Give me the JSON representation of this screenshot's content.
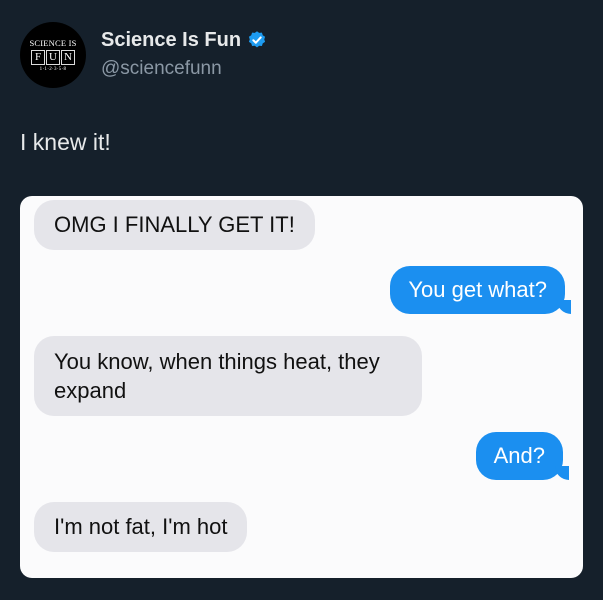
{
  "author": {
    "avatar": {
      "top": "SCIENCE IS",
      "letters": [
        "F",
        "U",
        "N"
      ],
      "bottom": "1·1·2·3·5·8"
    },
    "name": "Science Is Fun",
    "handle": "@sciencefunn",
    "verified_color": "#1d9bf0"
  },
  "tweet": {
    "text": "I knew it!"
  },
  "conversation": {
    "messages": [
      {
        "side": "received",
        "text": "OMG I FINALLY GET IT!"
      },
      {
        "side": "sent",
        "text": "You get what?"
      },
      {
        "side": "received",
        "text": "You know, when things heat, they expand"
      },
      {
        "side": "sent",
        "text": "And?"
      },
      {
        "side": "received",
        "text": "I'm not fat, I'm hot"
      }
    ],
    "colors": {
      "sent": "#1b8ff0",
      "received": "#e5e5ea"
    }
  }
}
